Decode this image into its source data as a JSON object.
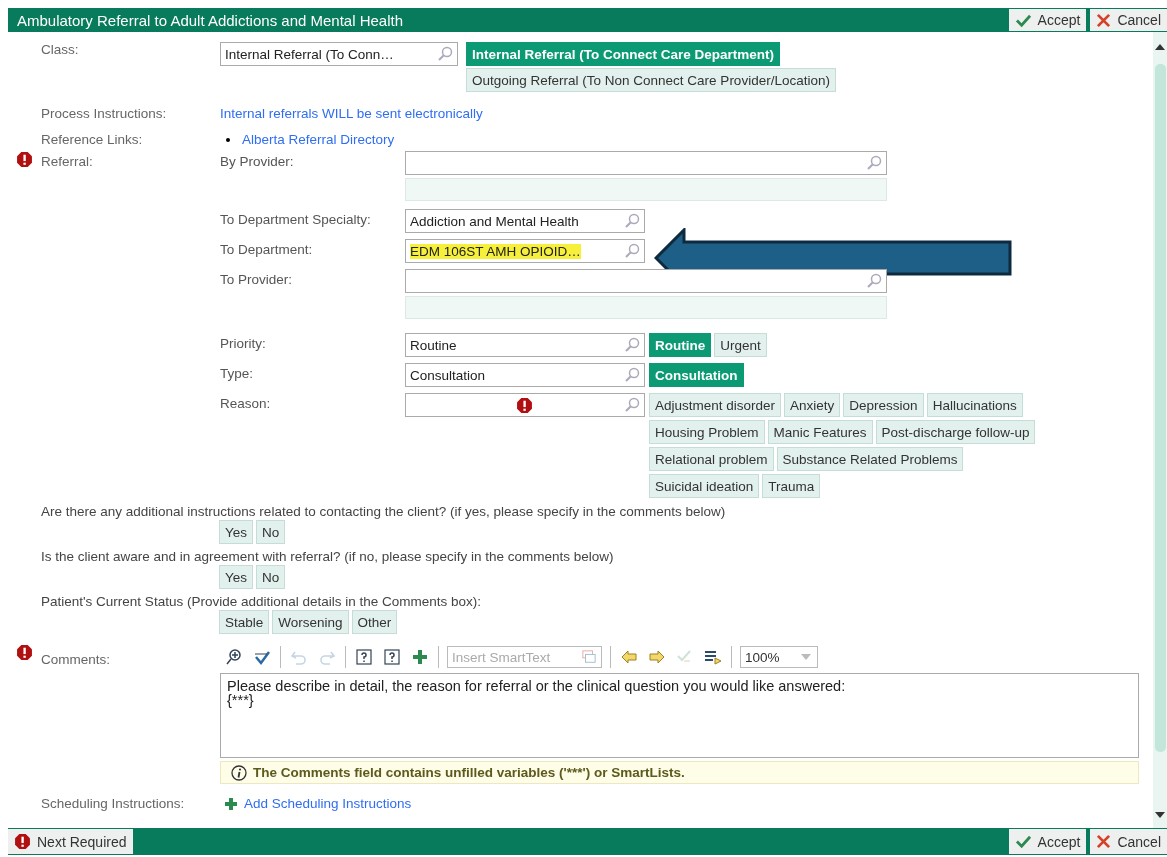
{
  "window": {
    "title": "Ambulatory Referral to Adult Addictions and Mental Health"
  },
  "header_buttons": [
    {
      "kind": "accept",
      "label": "Accept"
    },
    {
      "kind": "cancel",
      "label": "Cancel"
    }
  ],
  "class": {
    "label": "Class:",
    "value": "Internal Referral (To Conn…",
    "options": [
      {
        "label": "Internal Referral (To Connect Care Department)",
        "selected": true
      },
      {
        "label": "Outgoing Referral (To Non Connect Care Provider/Location)",
        "selected": false
      }
    ]
  },
  "process_instructions": {
    "label": "Process Instructions:",
    "text": "Internal referrals WILL be sent electronically"
  },
  "reference_links": {
    "label": "Reference Links:",
    "links": [
      "Alberta Referral Directory"
    ]
  },
  "referral": {
    "label": "Referral:",
    "required": true,
    "fields": [
      {
        "kind": "wide",
        "label": "By Provider:"
      },
      {
        "kind": "narrow",
        "label": "To Department Specialty:",
        "value": "Addiction and Mental Health",
        "highlighted": false
      },
      {
        "kind": "narrow",
        "label": "To Department:",
        "value": "EDM 106ST AMH OPIOID…",
        "highlighted": true,
        "pointed_at": true
      },
      {
        "kind": "wide",
        "label": "To Provider:"
      }
    ]
  },
  "priority": {
    "label": "Priority:",
    "value": "Routine",
    "option_rows": [
      [
        {
          "label": "Routine",
          "selected": true
        },
        {
          "label": "Urgent",
          "selected": false
        }
      ]
    ]
  },
  "type": {
    "label": "Type:",
    "value": "Consultation",
    "option_rows": [
      [
        {
          "label": "Consultation",
          "selected": true
        }
      ]
    ]
  },
  "reason": {
    "label": "Reason:",
    "required": true,
    "option_rows": [
      [
        {
          "label": "Adjustment disorder",
          "selected": false
        },
        {
          "label": "Anxiety",
          "selected": false
        },
        {
          "label": "Depression",
          "selected": false
        },
        {
          "label": "Hallucinations",
          "selected": false
        }
      ],
      [
        {
          "label": "Housing Problem",
          "selected": false
        },
        {
          "label": "Manic Features",
          "selected": false
        },
        {
          "label": "Post-discharge follow-up",
          "selected": false
        }
      ],
      [
        {
          "label": "Relational problem",
          "selected": false
        },
        {
          "label": "Substance Related Problems",
          "selected": false
        }
      ],
      [
        {
          "label": "Suicidal ideation",
          "selected": false
        },
        {
          "label": "Trauma",
          "selected": false
        }
      ]
    ]
  },
  "questions": [
    {
      "text": "Are there any additional instructions related to contacting the client? (if yes, please specify in the comments below)",
      "options": [
        {
          "label": "Yes",
          "selected": false
        },
        {
          "label": "No",
          "selected": false
        }
      ]
    },
    {
      "text": "Is the client aware and in agreement with referral? (if no, please specify in the comments below)",
      "options": [
        {
          "label": "Yes",
          "selected": false
        },
        {
          "label": "No",
          "selected": false
        }
      ]
    },
    {
      "text": "Patient's Current Status (Provide additional details in the Comments box):",
      "options": [
        {
          "label": "Stable",
          "selected": false
        },
        {
          "label": "Worsening",
          "selected": false
        },
        {
          "label": "Other",
          "selected": false
        }
      ]
    }
  ],
  "comments": {
    "label": "Comments:",
    "required": true,
    "toolbar": [
      {
        "kind": "zoom",
        "disabled": false
      },
      {
        "kind": "spellcheck",
        "disabled": false
      },
      {
        "kind": "separator"
      },
      {
        "kind": "undo",
        "disabled": true
      },
      {
        "kind": "redo",
        "disabled": true
      },
      {
        "kind": "separator"
      },
      {
        "kind": "help",
        "disabled": false
      },
      {
        "kind": "help-person",
        "disabled": false
      },
      {
        "kind": "add",
        "disabled": false
      },
      {
        "kind": "separator"
      },
      {
        "kind": "smarttext"
      },
      {
        "kind": "separator"
      },
      {
        "kind": "prev",
        "disabled": false
      },
      {
        "kind": "next",
        "disabled": false
      },
      {
        "kind": "sign",
        "disabled": true
      },
      {
        "kind": "list",
        "disabled": false
      },
      {
        "kind": "separator"
      },
      {
        "kind": "zoom-level"
      }
    ],
    "smarttext_placeholder": "Insert SmartText",
    "zoom_level": "100%",
    "lines": [
      "Please describe in detail, the reason for referral or the clinical question you would like answered:",
      "{***}"
    ],
    "warning": "The Comments field contains unfilled variables ('***') or SmartLists."
  },
  "scheduling": {
    "label": "Scheduling Instructions:",
    "link": "Add Scheduling Instructions"
  },
  "footer": {
    "next_required": "Next Required",
    "buttons": [
      {
        "kind": "accept",
        "label": "Accept"
      },
      {
        "kind": "cancel",
        "label": "Cancel"
      }
    ]
  }
}
